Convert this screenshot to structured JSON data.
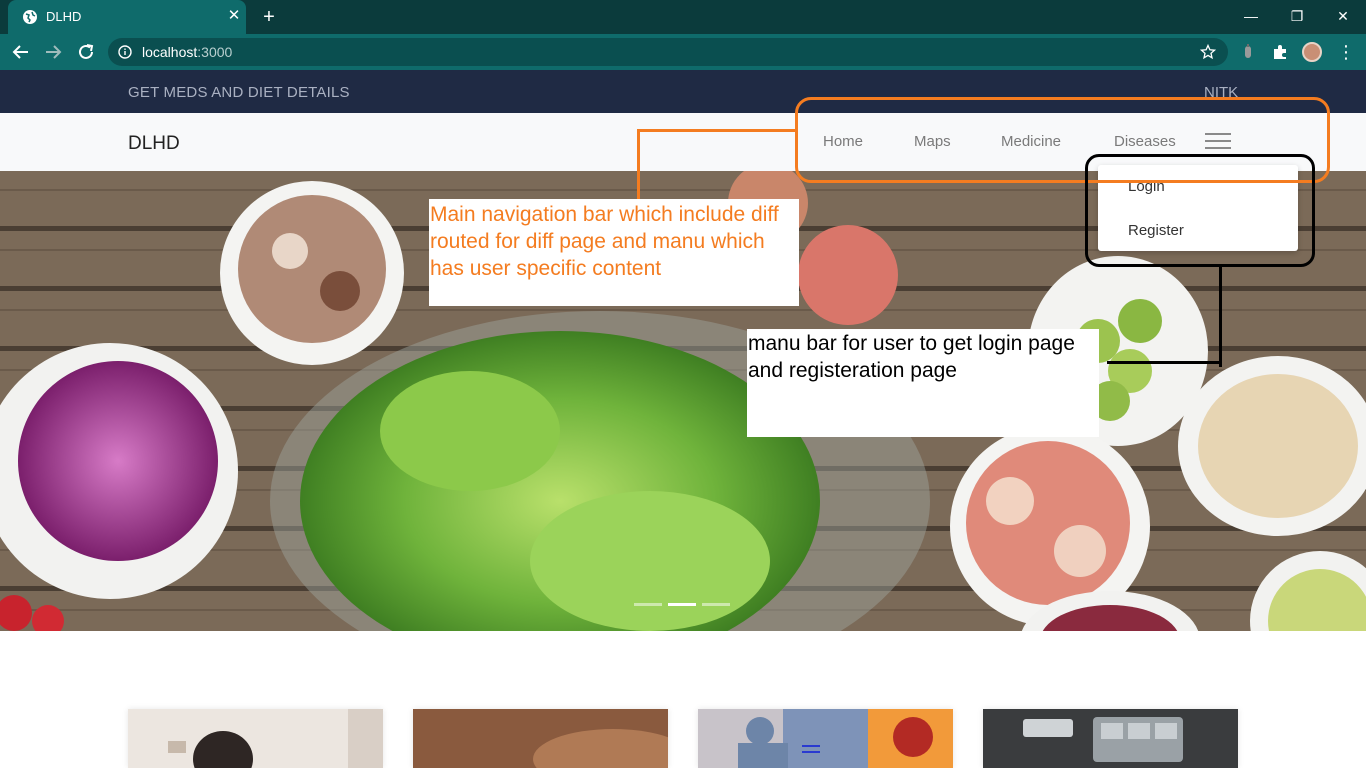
{
  "browser": {
    "tab_title": "DLHD",
    "url_host": "localhost",
    "url_port": ":3000",
    "tab_close": "✕",
    "new_tab": "+",
    "win_minimize": "—",
    "win_restore": "❐",
    "win_close": "✕",
    "menu": "⋮"
  },
  "site": {
    "topbar_left": "GET MEDS AND DIET DETAILS",
    "topbar_right": "NITK",
    "brand": "DLHD",
    "nav": [
      "Home",
      "Maps",
      "Medicine",
      "Diseases"
    ],
    "dropdown": [
      "Login",
      "Register"
    ]
  },
  "annotations": {
    "note1": "Main navigation bar which include diff routed for diff page and manu which has user specific content",
    "note2": "manu bar for user to get login page and registeration page"
  },
  "colors": {
    "tabstrip": "#0b3b3c",
    "toolbar": "#0f6b6b",
    "topbar": "#1f2a44",
    "navbar": "#f8f9fa",
    "annotation_orange": "#f47c20"
  },
  "icons": [
    "globe-icon",
    "back-icon",
    "forward-icon",
    "reload-icon",
    "info-icon",
    "star-icon",
    "extension-icon",
    "puzzle-icon",
    "hamburger-icon"
  ]
}
